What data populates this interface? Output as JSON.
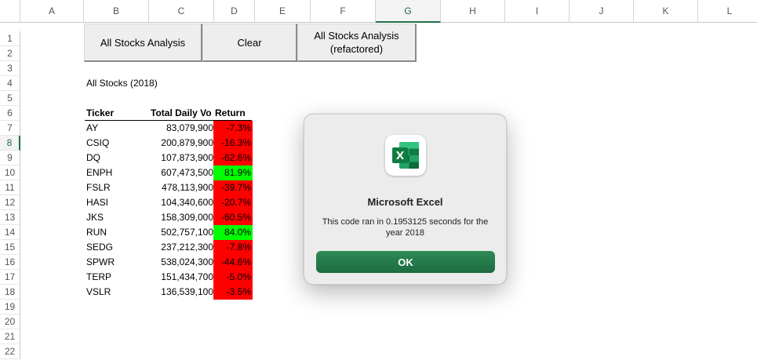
{
  "columns": [
    "A",
    "B",
    "C",
    "D",
    "E",
    "F",
    "G",
    "H",
    "I",
    "J",
    "K",
    "L"
  ],
  "rows": [
    "1",
    "2",
    "3",
    "4",
    "5",
    "6",
    "7",
    "8",
    "9",
    "10",
    "11",
    "12",
    "13",
    "14",
    "15",
    "16",
    "17",
    "18",
    "19",
    "20",
    "21",
    "22"
  ],
  "buttons": {
    "all_stocks": "All Stocks Analysis",
    "clear": "Clear",
    "refactored_line1": "All Stocks Analysis",
    "refactored_line2": "(refactored)"
  },
  "report": {
    "title": "All Stocks (2018)",
    "headers": {
      "ticker": "Ticker",
      "volume": "Total Daily Vo",
      "return": "Return"
    },
    "rows": [
      {
        "ticker": "AY",
        "volume": "83,079,900",
        "return": "-7.3%",
        "color": "#ff0000"
      },
      {
        "ticker": "CSIQ",
        "volume": "200,879,900",
        "return": "-16.3%",
        "color": "#ff0000"
      },
      {
        "ticker": "DQ",
        "volume": "107,873,900",
        "return": "-62.6%",
        "color": "#ff0000"
      },
      {
        "ticker": "ENPH",
        "volume": "607,473,500",
        "return": "81.9%",
        "color": "#00ff00"
      },
      {
        "ticker": "FSLR",
        "volume": "478,113,900",
        "return": "-39.7%",
        "color": "#ff0000"
      },
      {
        "ticker": "HASI",
        "volume": "104,340,600",
        "return": "-20.7%",
        "color": "#ff0000"
      },
      {
        "ticker": "JKS",
        "volume": "158,309,000",
        "return": "-60.5%",
        "color": "#ff0000"
      },
      {
        "ticker": "RUN",
        "volume": "502,757,100",
        "return": "84.0%",
        "color": "#00ff00"
      },
      {
        "ticker": "SEDG",
        "volume": "237,212,300",
        "return": "-7.8%",
        "color": "#ff0000"
      },
      {
        "ticker": "SPWR",
        "volume": "538,024,300",
        "return": "-44.6%",
        "color": "#ff0000"
      },
      {
        "ticker": "TERP",
        "volume": "151,434,700",
        "return": "-5.0%",
        "color": "#ff0000"
      },
      {
        "ticker": "VSLR",
        "volume": "136,539,100",
        "return": "-3.5%",
        "color": "#ff0000"
      }
    ]
  },
  "selected": {
    "column": "G",
    "row": "8"
  },
  "dialog": {
    "icon": "excel-app-icon",
    "title": "Microsoft Excel",
    "message": "This code ran in 0.1953125 seconds for the year 2018",
    "ok_label": "OK"
  }
}
